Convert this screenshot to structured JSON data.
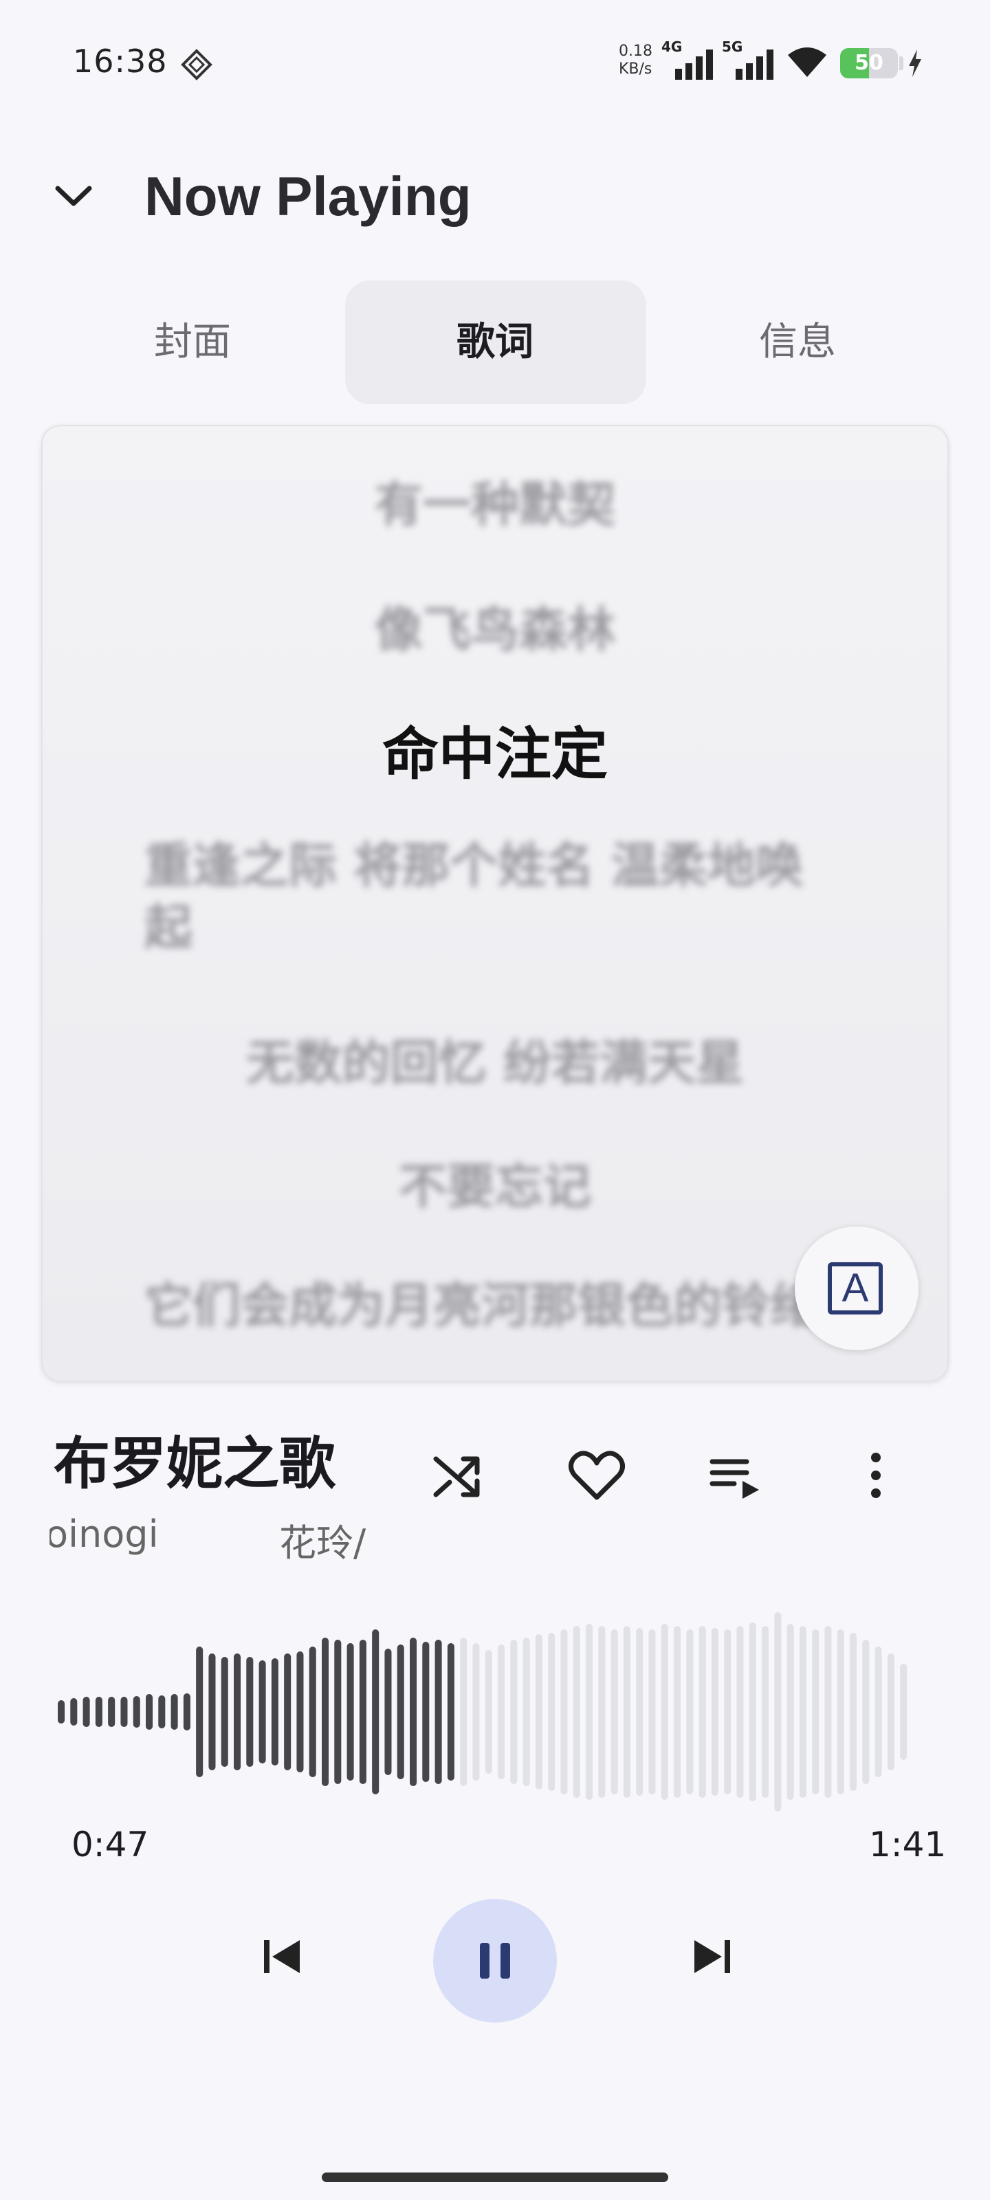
{
  "status_bar": {
    "time": "16:38",
    "net_speed_value": "0.18",
    "net_speed_unit": "KB/s",
    "sim1_label": "4G",
    "sim2_label": "5G",
    "battery_level": "50",
    "battery_percent": 50,
    "charging": true,
    "battery_color": "#57c35a"
  },
  "header": {
    "back_icon": "chevron-down-icon",
    "title": "Now Playing"
  },
  "tabs": [
    {
      "label": "封面",
      "active": false
    },
    {
      "label": "歌词",
      "active": true
    },
    {
      "label": "信息",
      "active": false
    }
  ],
  "lyrics": {
    "lines": [
      "有一种默契",
      "像飞鸟森林",
      "命中注定",
      "重逢之际 将那个姓名 温柔地唤起",
      "无数的回忆 纷若满天星",
      "不要忘记",
      "它们会成为月亮河那银色的铃绪"
    ],
    "current_index": 2,
    "translate_button_glyph": "A"
  },
  "song": {
    "title": "布罗妮之歌",
    "artist_part1": "oinogi",
    "artist_part2": "花玲/"
  },
  "actions": {
    "shuffle_icon": "shuffle-icon",
    "favorite_icon": "heart-icon",
    "queue_icon": "queue-icon",
    "more_icon": "more-vert-icon"
  },
  "progress": {
    "current_time": "0:47",
    "total_time": "1:41",
    "played_fraction": 0.465,
    "played_color": "#45454c",
    "remaining_color": "#e1e1e8"
  },
  "playback": {
    "prev_icon": "skip-previous-icon",
    "play_pause_icon": "pause-icon",
    "next_icon": "skip-next-icon",
    "accent_color": "#d9def8",
    "icon_color": "#2c3a72"
  }
}
